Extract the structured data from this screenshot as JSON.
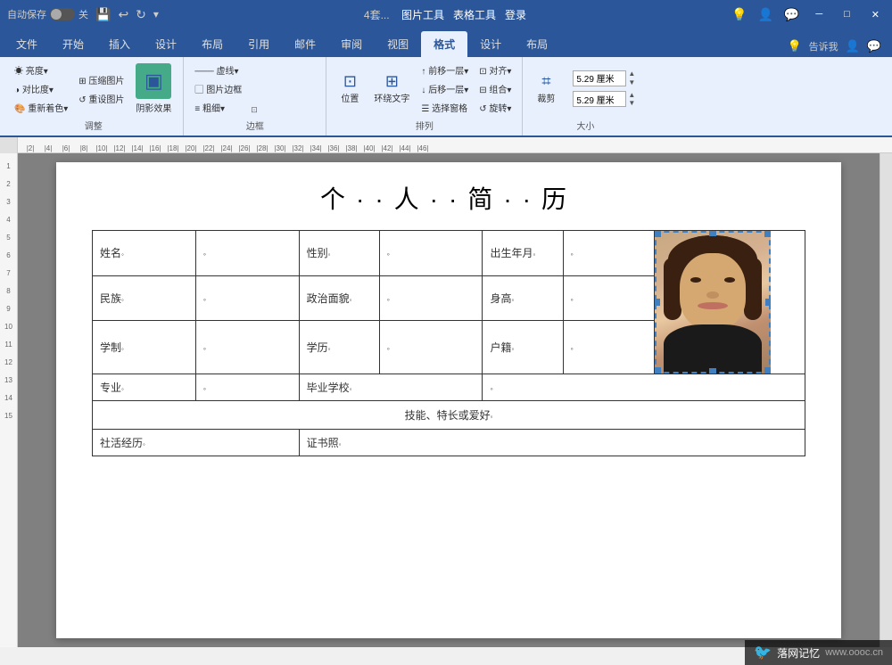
{
  "titlebar": {
    "autosave_label": "自动保存",
    "autosave_state": "关",
    "filename": "4套...",
    "tools_label1": "图片工具",
    "tools_label2": "表格工具",
    "login_label": "登录",
    "min_btn": "─",
    "restore_btn": "□",
    "close_btn": "✕"
  },
  "menu_tabs": [
    {
      "label": "文件",
      "active": false
    },
    {
      "label": "开始",
      "active": false
    },
    {
      "label": "插入",
      "active": false
    },
    {
      "label": "设计",
      "active": false
    },
    {
      "label": "布局",
      "active": false
    },
    {
      "label": "引用",
      "active": false
    },
    {
      "label": "邮件",
      "active": false
    },
    {
      "label": "审阅",
      "active": false
    },
    {
      "label": "视图",
      "active": false
    },
    {
      "label": "格式",
      "active": true
    },
    {
      "label": "设计",
      "active": false
    },
    {
      "label": "布局",
      "active": false
    }
  ],
  "ribbon_groups": {
    "adjust": {
      "title": "调整",
      "items": [
        {
          "label": "亮度▾",
          "icon": "☀"
        },
        {
          "label": "对比度▾",
          "icon": "◑"
        },
        {
          "label": "重新着色▾",
          "icon": "🎨"
        },
        {
          "label": "压缩图片",
          "icon": "⊞"
        },
        {
          "label": "重设图片",
          "icon": "↺"
        },
        {
          "label": "阴影效果",
          "icon": "▣"
        }
      ]
    },
    "border": {
      "title": "边框",
      "items": [
        {
          "label": "虚线▾",
          "icon": "─"
        },
        {
          "label": "图片边框",
          "icon": "▢"
        },
        {
          "label": "粗细▾",
          "icon": "≡"
        }
      ]
    },
    "arrange": {
      "title": "排列",
      "items": [
        {
          "label": "位置",
          "icon": "⊡"
        },
        {
          "label": "环绕文字",
          "icon": "⊞"
        },
        {
          "label": "前移一层",
          "icon": "↑"
        },
        {
          "label": "后移一层",
          "icon": "↓"
        },
        {
          "label": "选择窗格",
          "icon": "☰"
        }
      ]
    },
    "size": {
      "title": "大小",
      "width": "5.29 厘米",
      "height": "5.29 厘米"
    },
    "crop": {
      "label": "裁剪",
      "icon": "⌗"
    }
  },
  "help": {
    "label": "告诉我"
  },
  "document": {
    "title": "个··人··简··历",
    "table": {
      "rows": [
        {
          "cells": [
            {
              "label": "姓名",
              "dot": "◦",
              "type": "label",
              "colspan": 1
            },
            {
              "label": "",
              "dot": "◦",
              "type": "value",
              "colspan": 1
            },
            {
              "label": "性别",
              "dot": "◦",
              "type": "label",
              "colspan": 1
            },
            {
              "label": "",
              "dot": "◦",
              "type": "value",
              "colspan": 1
            },
            {
              "label": "出生年月",
              "dot": "◦",
              "type": "label",
              "colspan": 1
            },
            {
              "label": "",
              "dot": "◦",
              "type": "value",
              "colspan": 1
            },
            {
              "label": "photo",
              "type": "photo",
              "rowspan": 3
            }
          ]
        },
        {
          "cells": [
            {
              "label": "民族",
              "dot": "◦",
              "type": "label"
            },
            {
              "label": "",
              "dot": "◦",
              "type": "value"
            },
            {
              "label": "政治面貌",
              "dot": "◦",
              "type": "label"
            },
            {
              "label": "",
              "dot": "◦",
              "type": "value"
            },
            {
              "label": "身高",
              "dot": "◦",
              "type": "label"
            },
            {
              "label": "",
              "dot": "◦",
              "type": "value"
            }
          ]
        },
        {
          "cells": [
            {
              "label": "学制",
              "dot": "◦",
              "type": "label"
            },
            {
              "label": "",
              "dot": "◦",
              "type": "value"
            },
            {
              "label": "学历",
              "dot": "◦",
              "type": "label"
            },
            {
              "label": "",
              "dot": "◦",
              "type": "value"
            },
            {
              "label": "户籍",
              "dot": "◦",
              "type": "label"
            },
            {
              "label": "",
              "dot": "◦",
              "type": "value"
            }
          ]
        },
        {
          "cells": [
            {
              "label": "专业",
              "dot": "◦",
              "type": "label"
            },
            {
              "label": "",
              "dot": "◦",
              "type": "value"
            },
            {
              "label": "毕业学校",
              "dot": "◦",
              "type": "label",
              "colspan": 2
            },
            {
              "label": "",
              "dot": "◦",
              "type": "value",
              "colspan": 3
            }
          ]
        },
        {
          "cells": [
            {
              "label": "技能、特长或爱好",
              "dot": "◦",
              "type": "center",
              "colspan": 7
            }
          ]
        },
        {
          "cells": [
            {
              "label": "社活经历",
              "dot": "◦",
              "type": "label"
            },
            {
              "label": "",
              "dot": "◦",
              "type": "value"
            },
            {
              "label": "证书照",
              "dot": "◦",
              "type": "label",
              "colspan": 2
            }
          ]
        }
      ]
    }
  },
  "watermark": {
    "icon": "🐦",
    "text": "落网记忆",
    "url": "www.oooc.cn"
  },
  "ruler": {
    "marks": [
      "2",
      "4",
      "6",
      "8",
      "10",
      "12",
      "14",
      "16",
      "18",
      "20",
      "22",
      "24",
      "26",
      "28",
      "30",
      "32",
      "34",
      "36",
      "38",
      "40",
      "42",
      "44",
      "46"
    ]
  },
  "left_ruler_marks": [
    "1",
    "2",
    "3",
    "4",
    "5",
    "6",
    "7",
    "8",
    "9",
    "10",
    "11",
    "12",
    "13",
    "14",
    "15"
  ]
}
